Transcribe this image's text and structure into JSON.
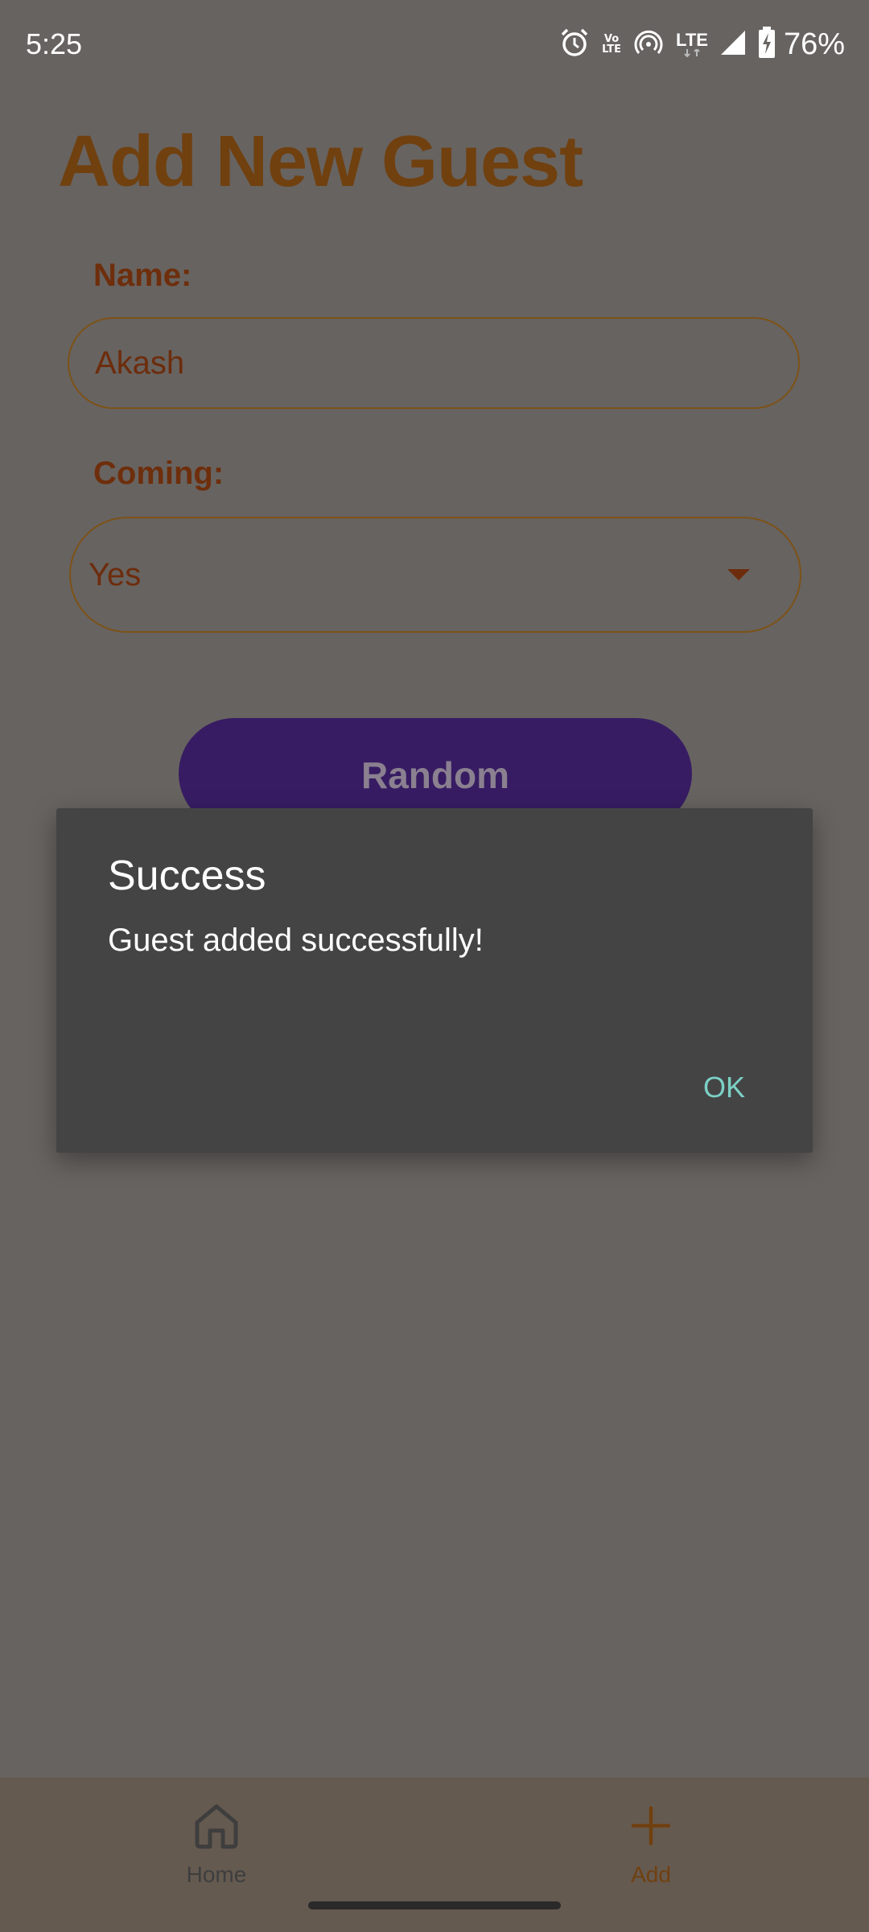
{
  "status_bar": {
    "time": "5:25",
    "vo_lte_top": "Vo",
    "vo_lte_bottom": "LTE",
    "lte": "LTE",
    "battery": "76%",
    "icons": [
      "alarm-icon",
      "volte-icon",
      "hotspot-icon",
      "lte-icon",
      "signal-icon",
      "battery-charging-icon"
    ]
  },
  "page": {
    "title": "Add New Guest",
    "name_label": "Name:",
    "name_value": "Akash",
    "coming_label": "Coming:",
    "coming_value": "Yes",
    "random_button": "Random"
  },
  "dialog": {
    "title": "Success",
    "message": "Guest added successfully!",
    "ok": "OK"
  },
  "bottom_nav": {
    "items": [
      {
        "label": "Home",
        "icon": "home-icon"
      },
      {
        "label": "Add",
        "icon": "plus-icon",
        "active": true
      }
    ]
  },
  "colors": {
    "scrim": "#676360",
    "title": "#70400f",
    "label": "#6e2e0c",
    "button": "#371c63",
    "dialog_bg": "#444444",
    "dialog_accent": "#7cd0c6"
  }
}
